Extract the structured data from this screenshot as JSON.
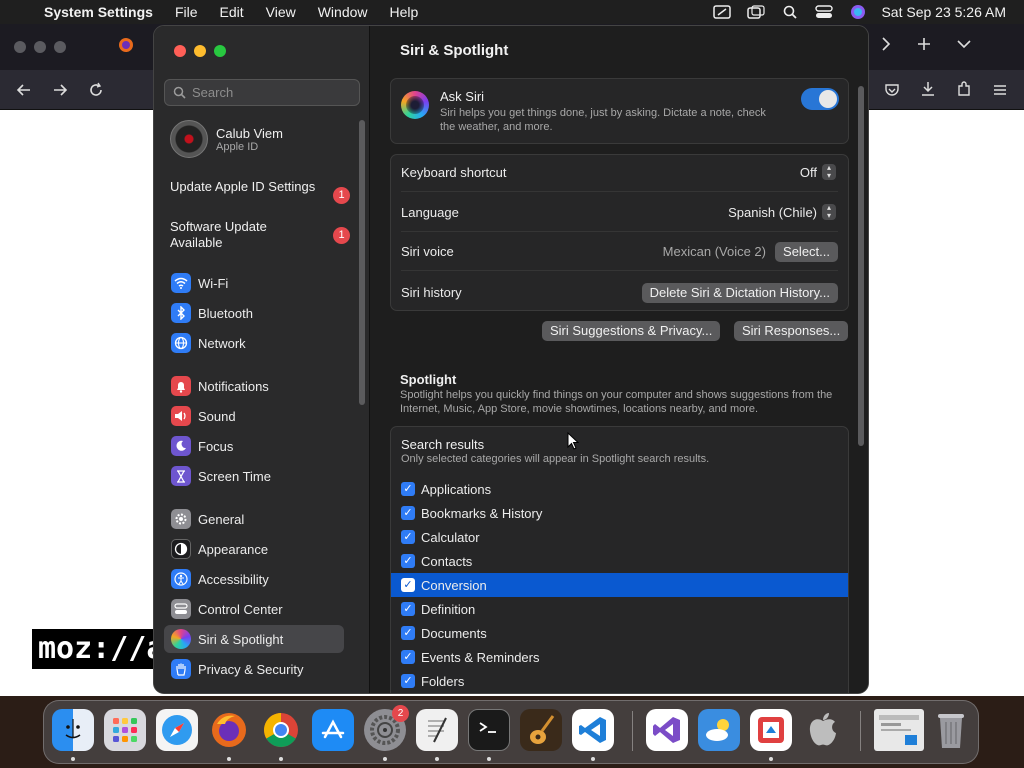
{
  "menubar": {
    "app_name": "System Settings",
    "menus": [
      "File",
      "Edit",
      "View",
      "Window",
      "Help"
    ],
    "clock": "Sat Sep 23  5:26 AM"
  },
  "browser": {
    "logo_text": "moz://a"
  },
  "sidebar": {
    "search_placeholder": "Search",
    "account": {
      "name": "Calub Viem",
      "subtitle": "Apple ID"
    },
    "notices": [
      {
        "label": "Update Apple ID Settings",
        "badge": "1"
      },
      {
        "label": "Software Update Available",
        "badge": "1"
      }
    ],
    "items": [
      {
        "label": "Wi-Fi",
        "icon": "wifi-icon",
        "color": "#2f7cf6"
      },
      {
        "label": "Bluetooth",
        "icon": "bluetooth-icon",
        "color": "#2f7cf6"
      },
      {
        "label": "Network",
        "icon": "globe-icon",
        "color": "#2f7cf6"
      },
      {
        "label": "Notifications",
        "icon": "bell-icon",
        "color": "#e5484d"
      },
      {
        "label": "Sound",
        "icon": "speaker-icon",
        "color": "#e5484d"
      },
      {
        "label": "Focus",
        "icon": "moon-icon",
        "color": "#6e56cf"
      },
      {
        "label": "Screen Time",
        "icon": "hourglass-icon",
        "color": "#6e56cf"
      },
      {
        "label": "General",
        "icon": "gear-icon",
        "color": "#8e8e93"
      },
      {
        "label": "Appearance",
        "icon": "appearance-icon",
        "color": "#1c1c1e"
      },
      {
        "label": "Accessibility",
        "icon": "accessibility-icon",
        "color": "#2f7cf6"
      },
      {
        "label": "Control Center",
        "icon": "control-center-icon",
        "color": "#8e8e93"
      },
      {
        "label": "Siri & Spotlight",
        "icon": "siri-icon",
        "color": "#7a3ff0",
        "selected": true
      },
      {
        "label": "Privacy & Security",
        "icon": "hand-icon",
        "color": "#2f7cf6"
      }
    ]
  },
  "main": {
    "title": "Siri & Spotlight",
    "ask_siri": {
      "title": "Ask Siri",
      "description": "Siri helps you get things done, just by asking. Dictate a note, check the weather, and more.",
      "enabled": true
    },
    "settings": {
      "keyboard_shortcut": {
        "label": "Keyboard shortcut",
        "value": "Off"
      },
      "language": {
        "label": "Language",
        "value": "Spanish (Chile)"
      },
      "siri_voice": {
        "label": "Siri voice",
        "value": "Mexican (Voice 2)",
        "button": "Select..."
      },
      "siri_history": {
        "label": "Siri history",
        "button": "Delete Siri & Dictation History..."
      }
    },
    "buttons": {
      "suggestions_privacy": "Siri Suggestions & Privacy...",
      "responses": "Siri Responses..."
    },
    "spotlight": {
      "title": "Spotlight",
      "description": "Spotlight helps you quickly find things on your computer and shows suggestions from the Internet, Music, App Store, movie showtimes, locations nearby, and more."
    },
    "search_results": {
      "title": "Search results",
      "subtitle": "Only selected categories will appear in Spotlight search results.",
      "items": [
        {
          "label": "Applications",
          "checked": true
        },
        {
          "label": "Bookmarks & History",
          "checked": true
        },
        {
          "label": "Calculator",
          "checked": true
        },
        {
          "label": "Contacts",
          "checked": true
        },
        {
          "label": "Conversion",
          "checked": true,
          "selected": true
        },
        {
          "label": "Definition",
          "checked": true
        },
        {
          "label": "Documents",
          "checked": true
        },
        {
          "label": "Events & Reminders",
          "checked": true
        },
        {
          "label": "Folders",
          "checked": true
        }
      ]
    }
  },
  "dock": {
    "apps": [
      {
        "name": "finder",
        "color": "#2b8ef0",
        "running": true
      },
      {
        "name": "launchpad",
        "color": "#d9d9de",
        "running": false
      },
      {
        "name": "safari",
        "color": "#2f9bf0",
        "running": false
      },
      {
        "name": "firefox",
        "color": "#e86a1c",
        "running": true
      },
      {
        "name": "chrome",
        "color": "#f2f2f2",
        "running": true
      },
      {
        "name": "app-store",
        "color": "#1e8bf5",
        "running": false
      },
      {
        "name": "system-settings",
        "color": "#8e8e93",
        "running": true,
        "badge": "2"
      },
      {
        "name": "textedit",
        "color": "#f0f0f0",
        "running": true
      },
      {
        "name": "terminal",
        "color": "#1a1a1a",
        "running": true
      },
      {
        "name": "garageband",
        "color": "#3a2a1a",
        "running": false
      },
      {
        "name": "vscode",
        "color": "#1f7fd8",
        "running": true
      },
      {
        "name": "visual-studio",
        "color": "#7b4cc7",
        "running": false
      },
      {
        "name": "weather",
        "color": "#3a8de0",
        "running": false
      },
      {
        "name": "remote-desktop",
        "color": "#e04040",
        "running": true
      },
      {
        "name": "apple-support",
        "color": "#bdbdbd",
        "running": false
      },
      {
        "name": "preview-window",
        "color": "#e8e8e8",
        "running": false
      },
      {
        "name": "trash",
        "color": "#9a9aa0",
        "running": false
      }
    ]
  }
}
